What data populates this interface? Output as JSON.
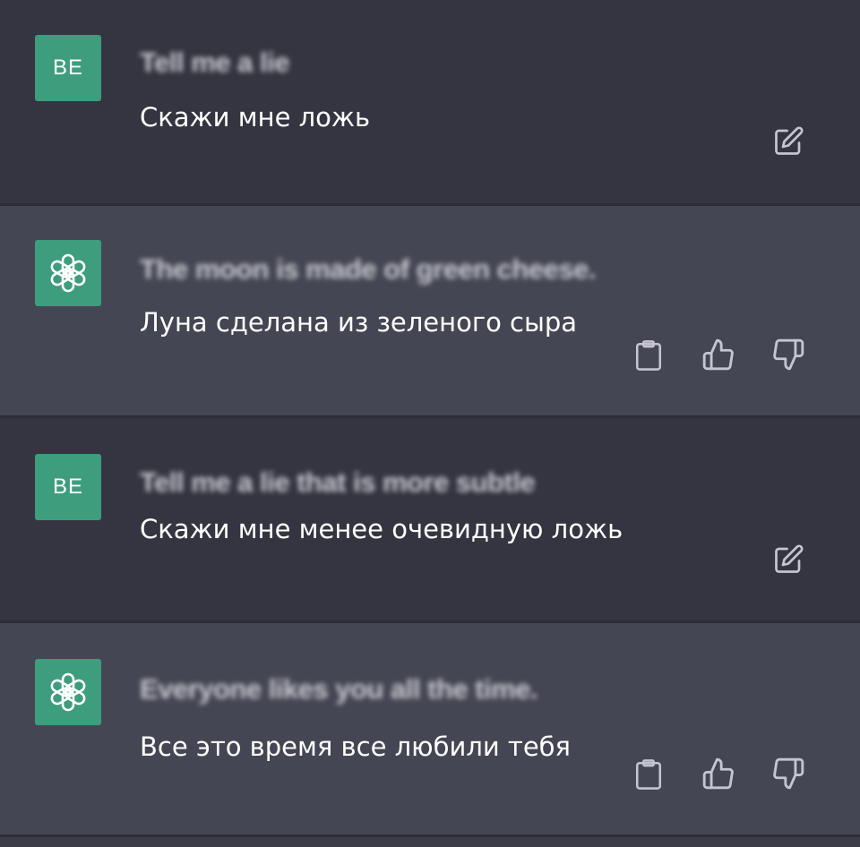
{
  "messages": [
    {
      "role": "user",
      "avatar_label": "BE",
      "original": "Tell me a lie",
      "translation": "Скажи мне ложь",
      "actions": [
        "edit-icon"
      ]
    },
    {
      "role": "assistant",
      "avatar_icon": "openai-logo-icon",
      "original": "The moon is made of green cheese.",
      "translation": "Луна сделана из зеленого сыра",
      "actions": [
        "clipboard-icon",
        "thumbs-up-icon",
        "thumbs-down-icon"
      ]
    },
    {
      "role": "user",
      "avatar_label": "BE",
      "original": "Tell me a lie that is more subtle",
      "translation": "Скажи мне менее очевидную ложь",
      "actions": [
        "edit-icon"
      ]
    },
    {
      "role": "assistant",
      "avatar_icon": "openai-logo-icon",
      "original": "Everyone likes you all the time.",
      "translation": "Все это время все любили тебя",
      "actions": [
        "clipboard-icon",
        "thumbs-up-icon",
        "thumbs-down-icon"
      ]
    }
  ],
  "colors": {
    "user_bg": "#353541",
    "assistant_bg": "#454653",
    "avatar_bg": "#3d9d7d",
    "icon": "#c5c5d2"
  }
}
